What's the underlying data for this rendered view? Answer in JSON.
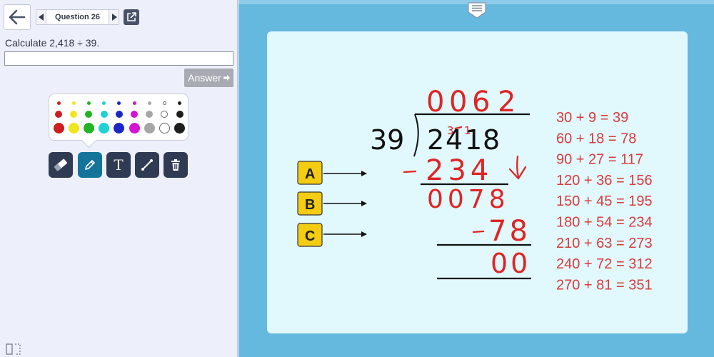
{
  "header": {
    "question_label": "Question 26",
    "back_icon": "arrow-left-icon",
    "popout_icon": "external-link-icon"
  },
  "question": {
    "text": "Calculate 2,418 ÷ 39.",
    "answer_value": "",
    "answer_label": "Answer"
  },
  "palette": {
    "rows": [
      [
        "#cc1f1f",
        "#f1e51c",
        "#22b522",
        "#1fd3d3",
        "#1a26c7",
        "#d414d4",
        "#a6a6a6",
        "#ffffff",
        "#1e1e1e"
      ],
      [
        "#cc1f1f",
        "#f1e51c",
        "#22b522",
        "#1fd3d3",
        "#1a26c7",
        "#d414d4",
        "#a6a6a6",
        "#ffffff",
        "#1e1e1e"
      ],
      [
        "#cc1f1f",
        "#f1e51c",
        "#22b522",
        "#1fd3d3",
        "#1a26c7",
        "#d414d4",
        "#a6a6a6",
        "#ffffff",
        "#1e1e1e"
      ]
    ]
  },
  "tools": {
    "text_tool_label": "T",
    "icons": [
      "eraser-icon",
      "pencil-icon",
      "text-icon",
      "line-icon",
      "trash-icon"
    ],
    "active": "pencil-icon"
  },
  "whiteboard": {
    "divisor": "39",
    "dividend_digits": [
      "2",
      "4",
      "1",
      "8"
    ],
    "quotient_digits": [
      "0",
      "0",
      "6",
      "2"
    ],
    "subtract_1": "234",
    "remainder_1": "0078",
    "subtract_2": "78",
    "final_remainder": "00",
    "carry_marks": [
      "3",
      "1"
    ],
    "step_labels": [
      "A",
      "B",
      "C"
    ],
    "multiples": [
      "30 + 9 = 39",
      "60 + 18 = 78",
      "90 + 27 = 117",
      "120 + 36 = 156",
      "150 + 45 = 195",
      "180 + 54 = 234",
      "210 + 63 = 273",
      "240 + 72 = 312",
      "270 + 81 = 351"
    ],
    "colors": {
      "ink": "#e02424",
      "label_box": "#f4cc12",
      "board": "#e1f8fd"
    }
  }
}
